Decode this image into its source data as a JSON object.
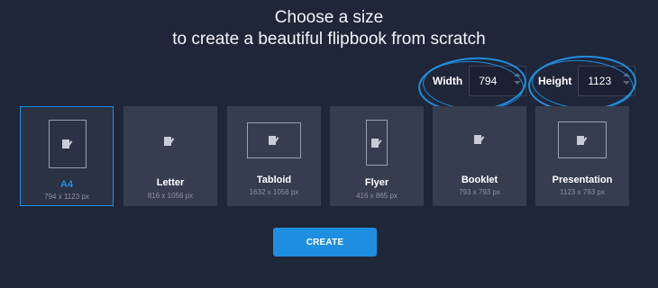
{
  "header": {
    "line1": "Choose a size",
    "line2": "to create a beautiful flipbook from scratch"
  },
  "dimensions": {
    "width": {
      "label": "Width",
      "value": "794"
    },
    "height": {
      "label": "Height",
      "value": "1123"
    }
  },
  "formats": [
    {
      "name": "A4",
      "size": "794 x 1123 px",
      "selected": true
    },
    {
      "name": "Letter",
      "size": "816 x 1056 px",
      "selected": false
    },
    {
      "name": "Tabloid",
      "size": "1632 x 1056 px",
      "selected": false
    },
    {
      "name": "Flyer",
      "size": "416 x 865 px",
      "selected": false
    },
    {
      "name": "Booklet",
      "size": "793 x 793 px",
      "selected": false
    },
    {
      "name": "Presentation",
      "size": "1123 x 793 px",
      "selected": false
    }
  ],
  "actions": {
    "create_label": "CREATE"
  },
  "icons": {
    "format_icon": "document-edit-icon",
    "spinner": "spinner-arrows-icon"
  },
  "colors": {
    "background": "#1f2638",
    "card": "#363d4f",
    "accent": "#1e8fe0"
  }
}
